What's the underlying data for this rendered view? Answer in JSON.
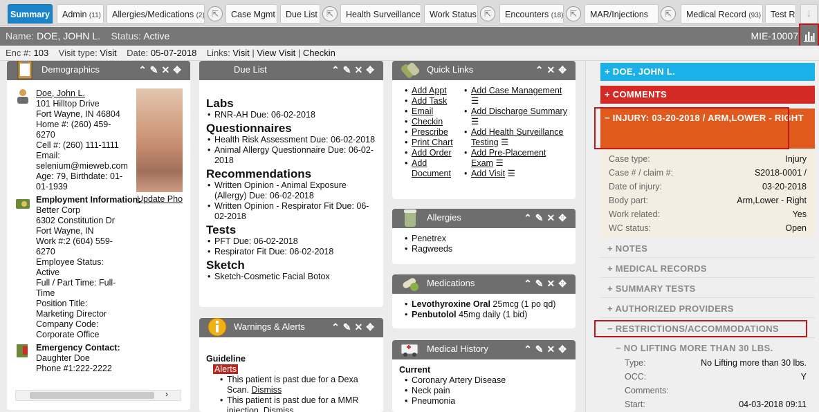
{
  "tabs": [
    {
      "label": "Summary",
      "count": "",
      "ext": false
    },
    {
      "label": "Admin",
      "count": "(11)",
      "ext": false
    },
    {
      "label": "Allergies/Medications",
      "count": "(2)",
      "ext": true
    },
    {
      "label": "Case Mgmt",
      "count": "",
      "ext": false
    },
    {
      "label": "Due List",
      "count": "",
      "ext": true
    },
    {
      "label": "Health Surveillance",
      "count": "",
      "ext": false
    },
    {
      "label": "Work Status",
      "count": "",
      "ext": true
    },
    {
      "label": "Encounters",
      "count": "(18)",
      "ext": true
    },
    {
      "label": "MAR/Injections",
      "count": "",
      "ext": true
    },
    {
      "label": "Medical Record",
      "count": "(93)",
      "ext": false
    },
    {
      "label": "Test R",
      "count": "",
      "ext": false
    }
  ],
  "header": {
    "name_label": "Name:",
    "name": "DOE, JOHN L.",
    "status_label": "Status:",
    "status": "Active",
    "mrn": "MIE-10007"
  },
  "encounter": {
    "enc_label": "Enc #:",
    "enc": "103",
    "visit_label": "Visit type:",
    "visit": "Visit",
    "date_label": "Date:",
    "date": "05-07-2018",
    "links_label": "Links:",
    "links": [
      "Visit",
      "View Visit",
      "Checkin"
    ]
  },
  "demographics": {
    "title": "Demographics",
    "name": "Doe, John L.",
    "address_lines": [
      "101 Hilltop Drive",
      "Fort Wayne, IN 46804",
      "Home #: (260) 459-",
      "6270",
      "Cell #: (260) 111-1111",
      "Email:",
      "selenium@mieweb.com",
      "Age: 79, Birthdate: 01-",
      "01-1939"
    ],
    "update_photo": "Update Pho",
    "employment_title": "Employment Information:",
    "employment_lines": [
      "Better Corp",
      "6302 Constitution Dr",
      "Fort Wayne, IN",
      "Work #:2 (604) 559-",
      "6270",
      "Employee Status:",
      "Active",
      "Full / Part Time: Full-",
      "Time",
      "Position Title:",
      "Marketing Director",
      "Company Code:",
      "Corporate Office"
    ],
    "emergency_title": "Emergency Contact:",
    "emergency_lines": [
      "Daughter Doe",
      "Phone #1:222-2222"
    ]
  },
  "duelist": {
    "title": "Due List",
    "sections": [
      {
        "heading": "Labs",
        "items": [
          "RNR-AH Due: 06-02-2018"
        ]
      },
      {
        "heading": "Questionnaires",
        "items": [
          "Health Risk Assessment Due: 06-02-2018",
          "Animal Allergy Questionnaire Due: 06-02-2018"
        ]
      },
      {
        "heading": "Recommendations",
        "items": [
          "Written Opinion - Animal Exposure (Allergy) Due: 06-02-2018",
          "Written Opinion - Respirator Fit Due: 06-02-2018"
        ]
      },
      {
        "heading": "Tests",
        "items": [
          "PFT Due: 06-02-2018",
          "Respirator Fit Due: 06-02-2018"
        ]
      },
      {
        "heading": "Sketch",
        "items": [
          "Sketch-Cosmetic Facial Botox"
        ]
      }
    ]
  },
  "warnings": {
    "title": "Warnings & Alerts",
    "guideline": "Guideline",
    "alerts_badge": "Alerts",
    "items": [
      {
        "text": "This patient is past due for a Dexa Scan.",
        "action": "Dismiss"
      },
      {
        "text": "This patient is past due for a MMR injection.",
        "action": "Dismiss"
      }
    ]
  },
  "quicklinks": {
    "title": "Quick Links",
    "left": [
      "Add Appt",
      "Add Task",
      "Email",
      "Checkin",
      "Prescribe",
      "Print Chart",
      "Add Order",
      "Add Document"
    ],
    "right": [
      "Add Case Management",
      "Add Discharge Summary",
      "Add Health Surveillance Testing",
      "Add Pre-Placement Exam",
      "Add Visit"
    ]
  },
  "allergies": {
    "title": "Allergies",
    "items": [
      "Penetrex",
      "Ragweeds"
    ]
  },
  "medications": {
    "title": "Medications",
    "items": [
      {
        "name": "Levothyroxine Oral",
        "dose": "25mcg (1 po qd)"
      },
      {
        "name": "Penbutolol",
        "dose": "45mg daily (1 bid)"
      }
    ]
  },
  "history": {
    "title": "Medical History",
    "current_label": "Current",
    "items": [
      "Coronary Artery Disease",
      "Neck pain",
      "Pneumonia"
    ]
  },
  "rightpanel": {
    "patient_bar": "+ DOE, JOHN L.",
    "comments_bar": "+ COMMENTS",
    "injury_bar": "− INJURY: 03-20-2018 / ARM,LOWER - RIGHT",
    "injury_fields": [
      {
        "label": "Case type:",
        "value": "Injury"
      },
      {
        "label": "Case # / claim #:",
        "value": "S2018-0001 /"
      },
      {
        "label": "Date of injury:",
        "value": "03-20-2018"
      },
      {
        "label": "Body part:",
        "value": "Arm,Lower - Right"
      },
      {
        "label": "Work related:",
        "value": "Yes"
      },
      {
        "label": "WC status:",
        "value": "Open"
      }
    ],
    "sections": [
      "+ NOTES",
      "+ MEDICAL RECORDS",
      "+ SUMMARY TESTS",
      "+ AUTHORIZED PROVIDERS"
    ],
    "restrictions": "− RESTRICTIONS/ACCOMMODATIONS",
    "restriction_item": "− NO LIFTING MORE THAN 30 LBS.",
    "restriction_fields": [
      {
        "label": "Type:",
        "value": "No Lifting more than 30 lbs."
      },
      {
        "label": "OCC:",
        "value": "Y"
      },
      {
        "label": "Comments:",
        "value": ""
      },
      {
        "label": "Start:",
        "value": "04-03-2018 09:11"
      }
    ]
  },
  "colors": {
    "tab_active": "#1b84c8",
    "patient_bar": "#1ab0e8",
    "comments_bar": "#d42a26",
    "injury_bar": "#e05a1e",
    "highlight_box": "#c01818"
  }
}
